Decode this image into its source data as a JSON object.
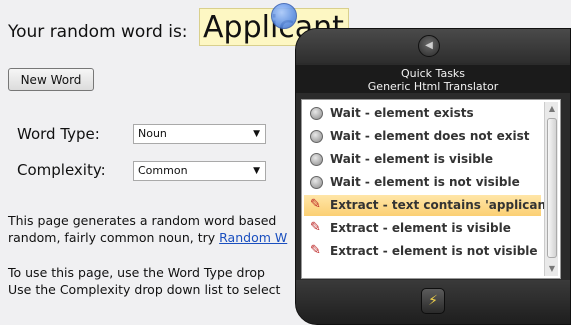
{
  "word": {
    "label": "Your random word is:",
    "value": "Applicant"
  },
  "new_word_button": "New Word",
  "word_type": {
    "label": "Word Type:",
    "selected": "Noun"
  },
  "complexity": {
    "label": "Complexity:",
    "selected": "Common"
  },
  "paragraphs": {
    "p1_line1": "This page generates a random word based",
    "p1_line2_prefix": "random, fairly common noun, try ",
    "p1_link": "Random W",
    "p2_line1": "To use this page, use the Word Type drop",
    "p2_line2": "Use the Complexity drop down list to select"
  },
  "quick_tasks": {
    "title": "Quick Tasks",
    "subtitle": "Generic Html Translator",
    "items": [
      {
        "label": "Wait - element exists",
        "icon": "wait-icon",
        "selected": false
      },
      {
        "label": "Wait - element does not exist",
        "icon": "wait-icon",
        "selected": false
      },
      {
        "label": "Wait - element is visible",
        "icon": "wait-icon",
        "selected": false
      },
      {
        "label": "Wait - element is not visible",
        "icon": "wait-icon",
        "selected": false
      },
      {
        "label": "Extract - text contains 'applicant'",
        "icon": "extract-icon",
        "selected": true
      },
      {
        "label": "Extract - element is visible",
        "icon": "extract-icon",
        "selected": false
      },
      {
        "label": "Extract - element is not visible",
        "icon": "extract-icon",
        "selected": false
      }
    ]
  },
  "colors": {
    "highlight_bg": "#fdf7c3",
    "selected_item": "#fbcf73",
    "panel_dark": "#2b2b2b",
    "link": "#1a4fbf"
  }
}
